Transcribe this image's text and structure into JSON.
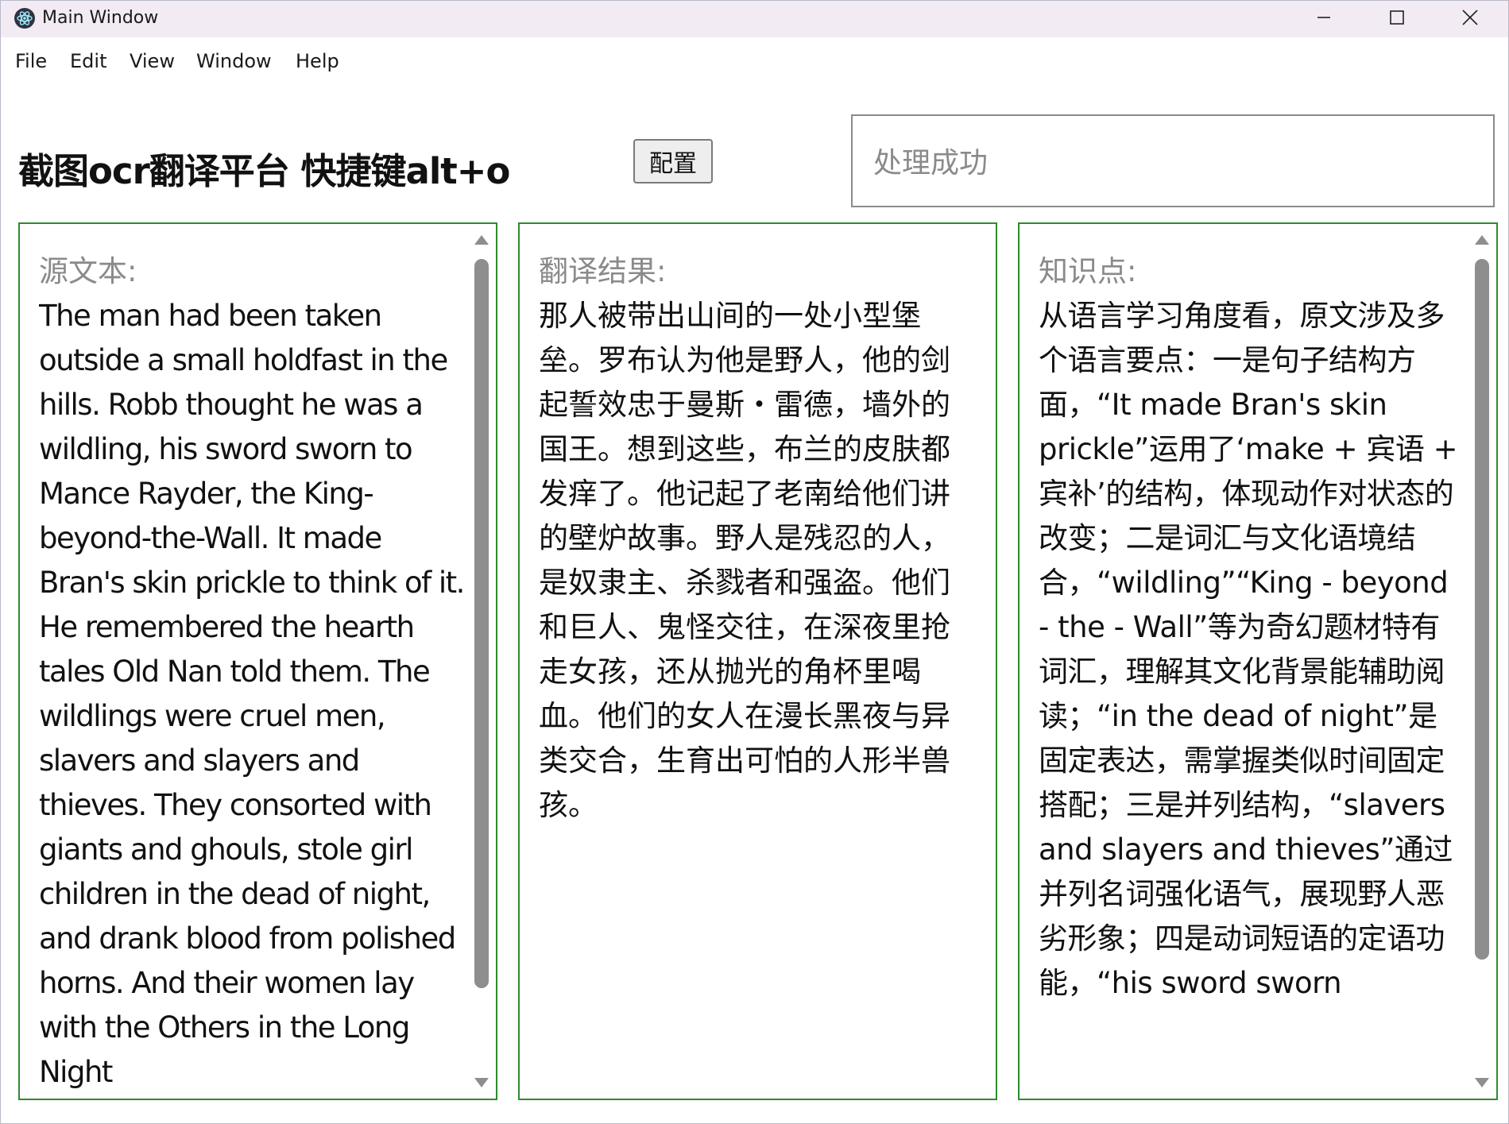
{
  "window": {
    "title": "Main Window"
  },
  "menu": {
    "items": [
      {
        "label": "File"
      },
      {
        "label": "Edit"
      },
      {
        "label": "View"
      },
      {
        "label": "Window"
      },
      {
        "label": "Help"
      }
    ]
  },
  "header": {
    "title": "截图ocr翻译平台 快捷键alt+o",
    "config_button": "配置",
    "status_value": "处理成功"
  },
  "panels": {
    "source": {
      "label": "源文本:",
      "text": "The man had been taken outside a small holdfast in the hills. Robb thought he was a wildling, his sword sworn to Mance Rayder, the King-beyond-the-Wall. It made Bran's skin prickle to think of it. He remembered the hearth tales Old Nan told them. The wildlings were cruel men, slavers and slayers and thieves. They consorted with giants and ghouls, stole girl children in the dead of night, and drank blood from polished horns. And their women lay with the Others in the Long Night"
    },
    "translation": {
      "label": "翻译结果:",
      "text": "那人被带出山间的一处小型堡垒。罗布认为他是野人，他的剑起誓效忠于曼斯・雷德，墙外的国王。想到这些，布兰的皮肤都发痒了。他记起了老南给他们讲的壁炉故事。野人是残忍的人，是奴隶主、杀戮者和强盗。他们和巨人、鬼怪交往，在深夜里抢走女孩，还从抛光的角杯里喝血。他们的女人在漫长黑夜与异类交合，生育出可怕的人形半兽孩。"
    },
    "knowledge": {
      "label": "知识点:",
      "text": "从语言学习角度看，原文涉及多个语言要点：一是句子结构方面，“It made Bran's skin prickle”运用了‘make + 宾语 + 宾补’的结构，体现动作对状态的改变；二是词汇与文化语境结合，“wildling”“King - beyond - the - Wall”等为奇幻题材特有词汇，理解其文化背景能辅助阅读；“in the dead of night”是固定表达，需掌握类似时间固定搭配；三是并列结构，“slavers and slayers and thieves”通过并列名词强化语气，展现野人恶劣形象；四是动词短语的定语功能，“his sword sworn"
    }
  },
  "colors": {
    "titlebar_bg": "#f2ebf4",
    "panel_border": "#2e8b2e",
    "label_gray": "#8a8a8a"
  }
}
